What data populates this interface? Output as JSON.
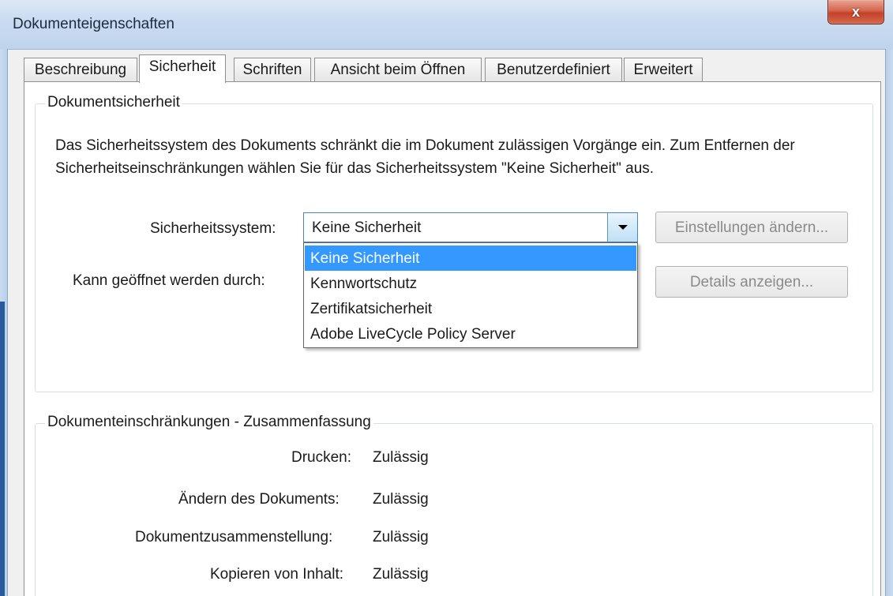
{
  "window": {
    "title": "Dokumenteigenschaften",
    "close_label": "x"
  },
  "tabs": [
    {
      "label": "Beschreibung"
    },
    {
      "label": "Sicherheit"
    },
    {
      "label": "Schriften"
    },
    {
      "label": "Ansicht beim Öffnen"
    },
    {
      "label": "Benutzerdefiniert"
    },
    {
      "label": "Erweitert"
    }
  ],
  "active_tab": "Sicherheit",
  "security_group": {
    "title": "Dokumentsicherheit",
    "description": "Das Sicherheitssystem des Dokuments schränkt die im Dokument zulässigen Vorgänge ein. Zum Entfernen der Sicherheitseinschränkungen wählen Sie für das Sicherheitssystem \"Keine Sicherheit\" aus.",
    "system_label": "Sicherheitssystem:",
    "system_value": "Keine Sicherheit",
    "options": [
      "Keine Sicherheit",
      "Kennwortschutz",
      "Zertifikatsicherheit",
      "Adobe LiveCycle Policy Server"
    ],
    "open_label": "Kann geöffnet werden durch:",
    "change_settings_button": "Einstellungen ändern...",
    "show_details_button": "Details anzeigen..."
  },
  "restrictions_group": {
    "title": "Dokumenteinschränkungen - Zusammenfassung",
    "rows": [
      {
        "label": "Drucken:",
        "value": "Zulässig"
      },
      {
        "label": "Ändern des Dokuments:",
        "value": "Zulässig"
      },
      {
        "label": "Dokumentzusammenstellung:",
        "value": "Zulässig"
      },
      {
        "label": "Kopieren von Inhalt:",
        "value": "Zulässig"
      }
    ]
  },
  "colors": {
    "selection": "#3399ff",
    "close_button": "#c2412a",
    "titlebar": "#c9dbf0"
  }
}
